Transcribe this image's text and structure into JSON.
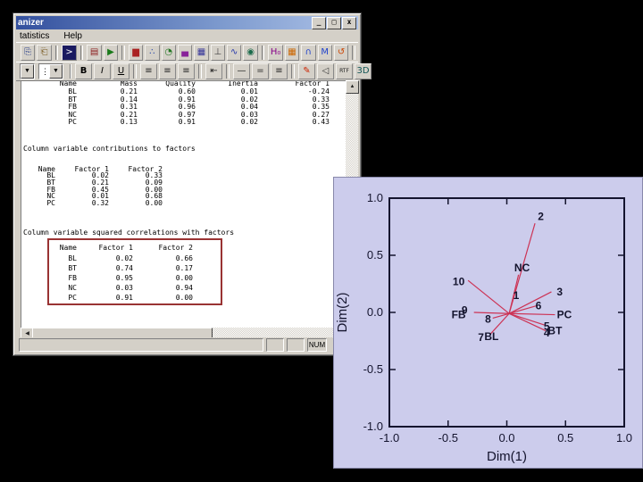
{
  "window": {
    "title": "anizer",
    "menu": [
      {
        "label": "tatistics"
      },
      {
        "label": "Help"
      }
    ],
    "titlebar_buttons": {
      "minimize": "_",
      "restore": "□",
      "close": "x"
    },
    "status": {
      "num_label": "NUM"
    }
  },
  "toolbar_row1": [
    {
      "name": "copy-icon",
      "glyph": "⎘",
      "color": "#223a8a"
    },
    {
      "name": "paste-icon",
      "glyph": "⎗",
      "color": "#7a5a20"
    },
    {
      "sep": true
    },
    {
      "name": "console-icon",
      "glyph": ">",
      "color": "#ffffff",
      "bg": "#1a1a60"
    },
    {
      "sep": true
    },
    {
      "name": "output-window-icon",
      "glyph": "▤",
      "color": "#8a1a1a"
    },
    {
      "name": "run-icon",
      "glyph": "▶",
      "color": "#1a7a1a"
    },
    {
      "sep": true
    },
    {
      "name": "bar-chart-icon",
      "glyph": "▆",
      "color": "#aa2222"
    },
    {
      "name": "scatter-plot-icon",
      "glyph": "∴",
      "color": "#2244aa"
    },
    {
      "name": "pie-chart-icon",
      "glyph": "◔",
      "color": "#227722"
    },
    {
      "name": "histogram-icon",
      "glyph": "▄",
      "color": "#882299"
    },
    {
      "name": "matrix-plot-icon",
      "glyph": "▦",
      "color": "#333399"
    },
    {
      "name": "box-plot-icon",
      "glyph": "⊥",
      "color": "#444444"
    },
    {
      "name": "line-plot-icon",
      "glyph": "∿",
      "color": "#2233aa"
    },
    {
      "name": "globe-icon",
      "glyph": "◉",
      "color": "#1a6a4a"
    },
    {
      "sep": true
    },
    {
      "name": "hypothesis-icon",
      "glyph": "H₀",
      "color": "#880088"
    },
    {
      "name": "data-grid-icon",
      "glyph": "▦",
      "color": "#cc6600"
    },
    {
      "name": "normal-curve-icon",
      "glyph": "∩",
      "color": "#2244cc"
    },
    {
      "name": "two-peaks-icon",
      "glyph": "M",
      "color": "#2244cc"
    },
    {
      "name": "reset-icon",
      "glyph": "↺",
      "color": "#cc4400"
    },
    {
      "sep": true
    }
  ],
  "toolbar_row2": [
    {
      "name": "bold-button",
      "glyph": "B",
      "color": "#000000",
      "bold": true
    },
    {
      "name": "italic-button",
      "glyph": "I",
      "color": "#000000",
      "italic": true
    },
    {
      "name": "underline-button",
      "glyph": "U",
      "color": "#000000",
      "underline": true
    },
    {
      "sep": true
    },
    {
      "name": "align-left-icon",
      "glyph": "≡",
      "color": "#222222"
    },
    {
      "name": "align-center-icon",
      "glyph": "≡",
      "color": "#222222"
    },
    {
      "name": "align-right-icon",
      "glyph": "≡",
      "color": "#222222"
    },
    {
      "sep": true
    },
    {
      "name": "indent-icon",
      "glyph": "⇤",
      "color": "#222222"
    },
    {
      "sep": true
    },
    {
      "name": "single-space-icon",
      "glyph": "—",
      "color": "#222222"
    },
    {
      "name": "one-half-space-icon",
      "glyph": "=",
      "color": "#222222"
    },
    {
      "name": "double-space-icon",
      "glyph": "≡",
      "color": "#222222"
    },
    {
      "sep": true
    },
    {
      "name": "marker-icon",
      "glyph": "✎",
      "color": "#cc2200"
    },
    {
      "name": "speaker-icon",
      "glyph": "◁",
      "color": "#333333"
    },
    {
      "name": "rtf-icon",
      "glyph": "RTF",
      "color": "#222222"
    },
    {
      "name": "threed-icon",
      "glyph": "3D",
      "color": "#115555"
    }
  ],
  "document": {
    "table1": {
      "headers": [
        "Name",
        "Mass",
        "Quality",
        "Inertia",
        "Factor 1"
      ],
      "rows": [
        [
          "BL",
          "0.21",
          "0.60",
          "0.01",
          "-0.24"
        ],
        [
          "BT",
          "0.14",
          "0.91",
          "0.02",
          "0.33"
        ],
        [
          "FB",
          "0.31",
          "0.96",
          "0.04",
          "0.35"
        ],
        [
          "NC",
          "0.21",
          "0.97",
          "0.03",
          "0.27"
        ],
        [
          "PC",
          "0.13",
          "0.91",
          "0.02",
          "0.43"
        ]
      ]
    },
    "heading1": "Column variable contributions to factors",
    "table2": {
      "headers": [
        "Name",
        "Factor 1",
        "Factor 2"
      ],
      "rows": [
        [
          "BL",
          "0.02",
          "0.33"
        ],
        [
          "BT",
          "0.21",
          "0.09"
        ],
        [
          "FB",
          "0.45",
          "0.00"
        ],
        [
          "NC",
          "0.01",
          "0.68"
        ],
        [
          "PC",
          "0.32",
          "0.00"
        ]
      ]
    },
    "heading2": "Column variable squared correlations with factors",
    "table3": {
      "headers": [
        "Name",
        "Factor 1",
        "Factor 2"
      ],
      "rows": [
        [
          "BL",
          "0.02",
          "0.66"
        ],
        [
          "BT",
          "0.74",
          "0.17"
        ],
        [
          "FB",
          "0.95",
          "0.00"
        ],
        [
          "NC",
          "0.03",
          "0.94"
        ],
        [
          "PC",
          "0.91",
          "0.00"
        ]
      ]
    }
  },
  "chart_data": {
    "type": "scatter",
    "title": "",
    "xlabel": "Dim(1)",
    "ylabel": "Dim(2)",
    "xlim": [
      -1,
      1
    ],
    "ylim": [
      -1,
      1
    ],
    "xticks": [
      -1.0,
      -0.5,
      0.0,
      0.5,
      1.0
    ],
    "yticks": [
      -1.0,
      -0.5,
      0.0,
      0.5,
      1.0
    ],
    "grid": false,
    "background": "#ccccec",
    "line_color": "#cc3355",
    "label_color": "#14142e",
    "origin": [
      0.02,
      -0.01
    ],
    "points": [
      {
        "label": "2",
        "x": 0.24,
        "y": 0.78,
        "lx": 0.29,
        "ly": 0.84,
        "line": true
      },
      {
        "label": "NC",
        "x": 0.1,
        "y": 0.33,
        "lx": 0.13,
        "ly": 0.39,
        "line": true
      },
      {
        "label": "10",
        "x": -0.33,
        "y": 0.28,
        "lx": -0.41,
        "ly": 0.27,
        "line": true
      },
      {
        "label": "1",
        "x": 0.08,
        "y": 0.15,
        "lx": 0.08,
        "ly": 0.15,
        "line": false
      },
      {
        "label": "3",
        "x": 0.38,
        "y": 0.18,
        "lx": 0.45,
        "ly": 0.18,
        "line": true
      },
      {
        "label": "6",
        "x": 0.26,
        "y": 0.06,
        "lx": 0.27,
        "ly": 0.06,
        "line": true
      },
      {
        "label": "PC",
        "x": 0.41,
        "y": -0.02,
        "lx": 0.49,
        "ly": -0.02,
        "line": true
      },
      {
        "label": "FB",
        "x": -0.28,
        "y": 0.0,
        "lx": -0.41,
        "ly": -0.02,
        "line": true
      },
      {
        "label": "9",
        "x": -0.3,
        "y": 0.02,
        "lx": -0.36,
        "ly": 0.02,
        "line": false
      },
      {
        "label": "8",
        "x": -0.12,
        "y": -0.05,
        "lx": -0.16,
        "ly": -0.06,
        "line": true
      },
      {
        "label": "7",
        "x": -0.17,
        "y": -0.21,
        "lx": -0.22,
        "ly": -0.22,
        "line": false
      },
      {
        "label": "BL",
        "x": -0.14,
        "y": -0.19,
        "lx": -0.13,
        "ly": -0.21,
        "line": true
      },
      {
        "label": "5",
        "x": 0.32,
        "y": -0.11,
        "lx": 0.34,
        "ly": -0.12,
        "line": true
      },
      {
        "label": "4",
        "x": 0.33,
        "y": -0.17,
        "lx": 0.34,
        "ly": -0.18,
        "line": false
      },
      {
        "label": "BT",
        "x": 0.33,
        "y": -0.16,
        "lx": 0.41,
        "ly": -0.16,
        "line": true
      }
    ]
  }
}
